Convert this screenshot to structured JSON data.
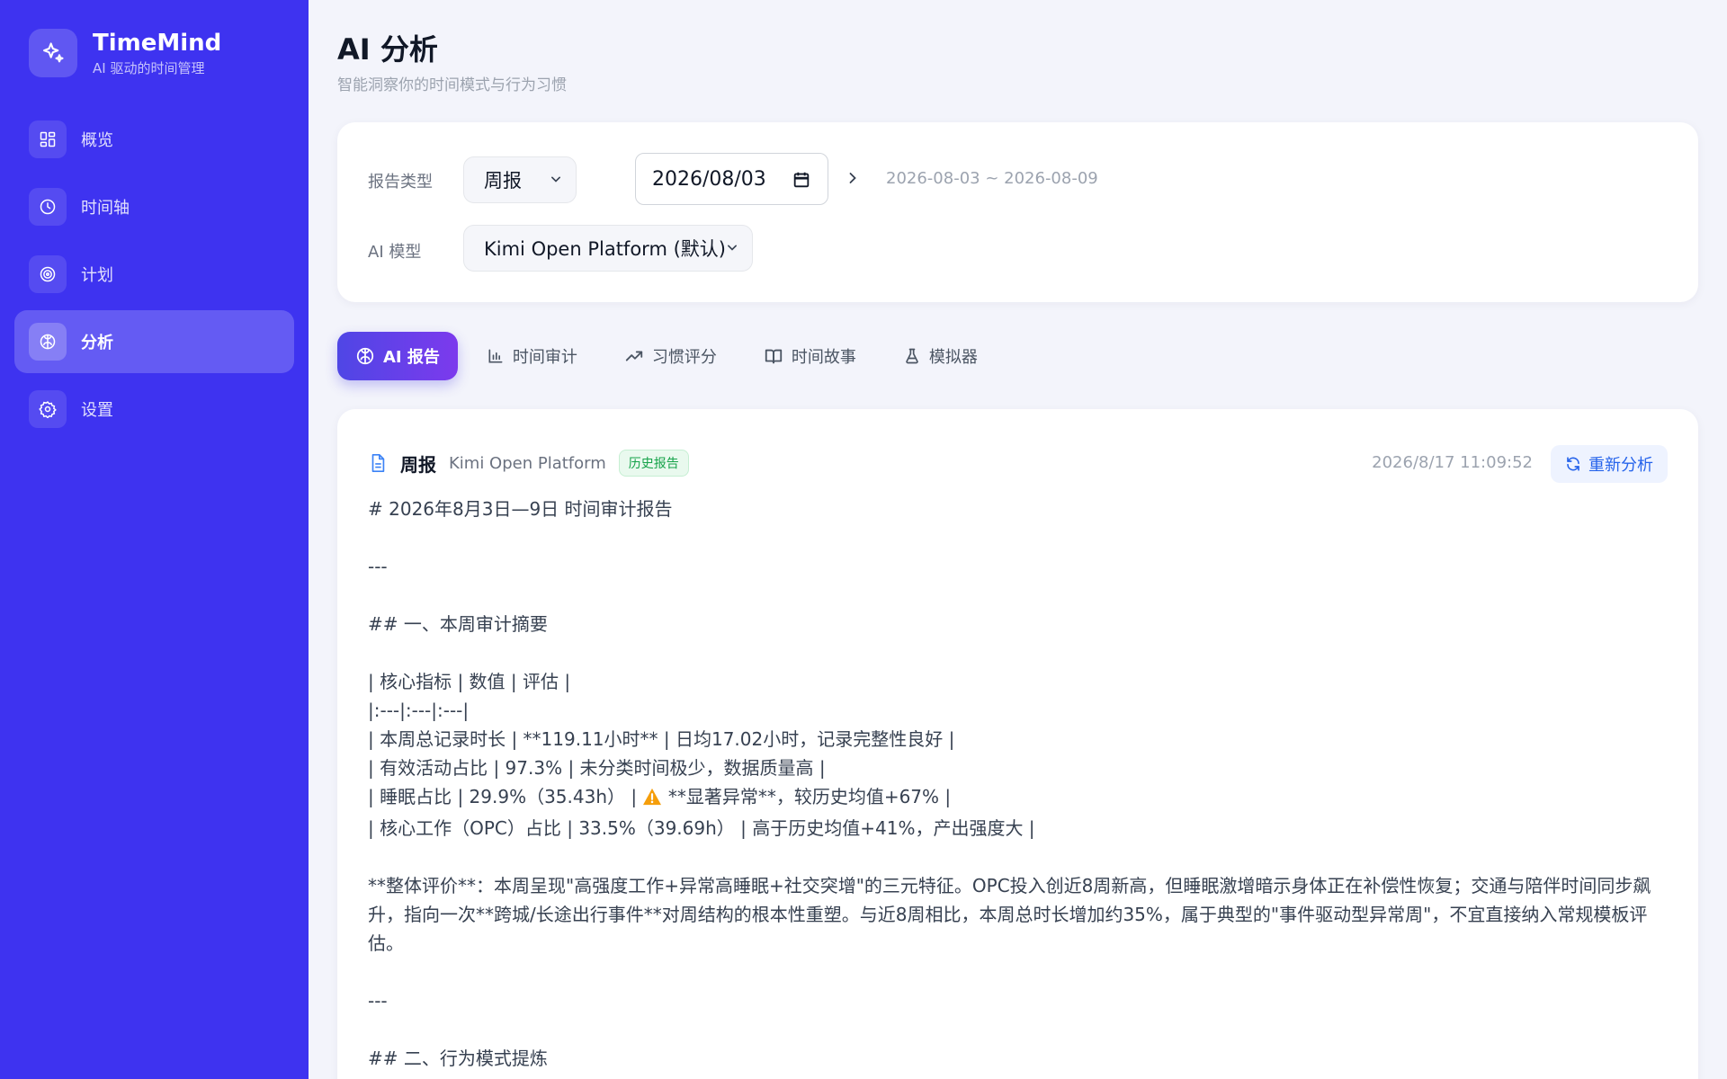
{
  "brand": {
    "title": "TimeMind",
    "subtitle": "AI 驱动的时间管理"
  },
  "sidebar": {
    "items": [
      {
        "label": "概览",
        "icon": "grid-icon",
        "active": false
      },
      {
        "label": "时间轴",
        "icon": "clock-icon",
        "active": false
      },
      {
        "label": "计划",
        "icon": "target-icon",
        "active": false
      },
      {
        "label": "分析",
        "icon": "brain-icon",
        "active": true
      },
      {
        "label": "设置",
        "icon": "gear-icon",
        "active": false
      }
    ]
  },
  "header": {
    "title": "AI 分析",
    "subtitle": "智能洞察你的时间模式与行为习惯"
  },
  "filters": {
    "report_type_label": "报告类型",
    "report_type_value": "周报",
    "date_value": "2026/08/03",
    "range_text": "2026-08-03 ~ 2026-08-09",
    "model_label": "AI 模型",
    "model_value": "Kimi Open Platform (默认)"
  },
  "tabs": [
    {
      "label": "AI 报告",
      "icon": "brain-icon",
      "active": true
    },
    {
      "label": "时间审计",
      "icon": "bar-chart-icon",
      "active": false
    },
    {
      "label": "习惯评分",
      "icon": "trend-up-icon",
      "active": false
    },
    {
      "label": "时间故事",
      "icon": "book-icon",
      "active": false
    },
    {
      "label": "模拟器",
      "icon": "flask-icon",
      "active": false
    }
  ],
  "report": {
    "title": "周报",
    "model": "Kimi Open Platform",
    "badge": "历史报告",
    "timestamp": "2026/8/17 11:09:52",
    "reanalyze_label": "重新分析",
    "lines": {
      "h1": "# 2026年8月3日—9日 时间审计报告",
      "hr1": "---",
      "h2a": "## 一、本周审计摘要",
      "t_head": "| 核心指标 | 数值 | 评估 |",
      "t_sep": "|:---|:---|:---|",
      "t_r1": "| 本周总记录时长 | **119.11小时** | 日均17.02小时，记录完整性良好 |",
      "t_r2": "| 有效活动占比 | 97.3% | 未分类时间极少，数据质量高 |",
      "t_r3_a": "| 睡眠占比 | 29.9%（35.43h） | ",
      "t_r3_b": " **显著异常**，较历史均值+67% |",
      "t_r4": "| 核心工作（OPC）占比 | 33.5%（39.69h） | 高于历史均值+41%，产出强度大 |",
      "summary": "**整体评价**：本周呈现\"高强度工作+异常高睡眠+社交突增\"的三元特征。OPC投入创近8周新高，但睡眠激增暗示身体正在补偿性恢复；交通与陪伴时间同步飙升，指向一次**跨城/长途出行事件**对周结构的根本性重塑。与近8周相比，本周总时长增加约35%，属于典型的\"事件驱动型异常周\"，不宜直接纳入常规模板评估。",
      "hr2": "---",
      "h2b": "## 二、行为模式提炼"
    }
  },
  "colors": {
    "sidebar": "#3e33f0",
    "accent": "#4f46e5",
    "badge_green": "#16a34a",
    "link_blue": "#2563eb"
  }
}
